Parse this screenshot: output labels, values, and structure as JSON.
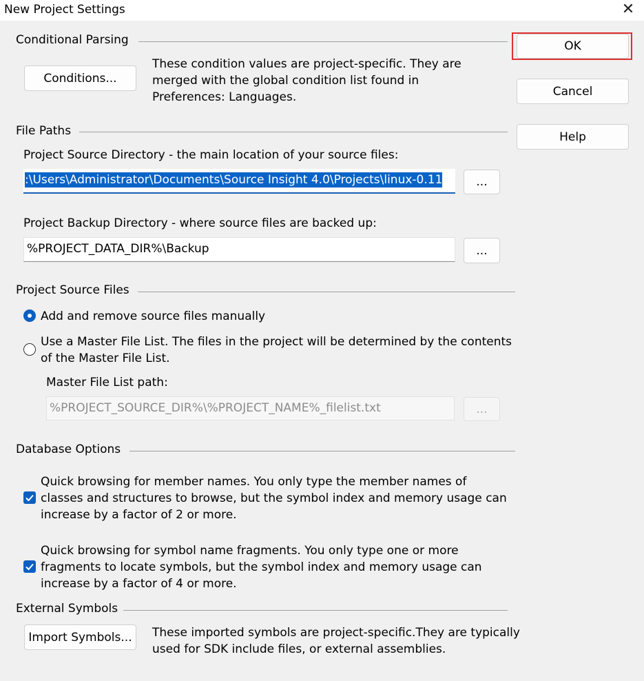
{
  "window": {
    "title": "New Project Settings",
    "close_glyph": "✕"
  },
  "buttons": {
    "ok": "OK",
    "cancel": "Cancel",
    "help": "Help"
  },
  "conditional_parsing": {
    "heading": "Conditional Parsing",
    "button": "Conditions...",
    "desc_lines": [
      "These condition values are project-specific.  They are",
      "merged with the global condition list found in",
      "Preferences: Languages."
    ]
  },
  "file_paths": {
    "heading": "File Paths",
    "source_label": "Project Source Directory - the main location of your source files:",
    "source_value": ":\\Users\\Administrator\\Documents\\Source Insight 4.0\\Projects\\linux-0.11",
    "backup_label": "Project Backup Directory - where source files are backed up:",
    "backup_value": "%PROJECT_DATA_DIR%\\Backup",
    "browse": "..."
  },
  "source_files": {
    "heading": "Project Source Files",
    "option_manual": "Add and remove source files manually",
    "option_master_lines": [
      "Use a Master File List. The files in the project will be determined by the contents",
      "of the Master File List."
    ],
    "selected": "manual",
    "master_path_label": "Master File List path:",
    "master_path_value": "%PROJECT_SOURCE_DIR%\\%PROJECT_NAME%_filelist.txt",
    "browse": "..."
  },
  "database_options": {
    "heading": "Database Options",
    "member_names_lines": [
      "Quick browsing for member names.  You only type the member names of",
      "classes and structures to browse, but the symbol index and memory usage can",
      "increase by a factor of 2 or more."
    ],
    "member_names_checked": true,
    "fragments_lines": [
      "Quick browsing for symbol name fragments.  You only type one or more",
      "fragments to locate symbols, but the symbol index and memory usage can",
      "increase by a factor of 4 or more."
    ],
    "fragments_checked": true
  },
  "external_symbols": {
    "heading": "External Symbols",
    "button": "Import Symbols...",
    "desc_lines": [
      "These imported symbols are project-specific.They are typically",
      "used for SDK include files, or external assemblies."
    ]
  },
  "colors": {
    "accent": "#0a5fc2",
    "highlight": "#e03030"
  },
  "icons": {
    "close": "close-icon",
    "radio": "radio-icon",
    "checkbox": "checkmark-icon"
  }
}
